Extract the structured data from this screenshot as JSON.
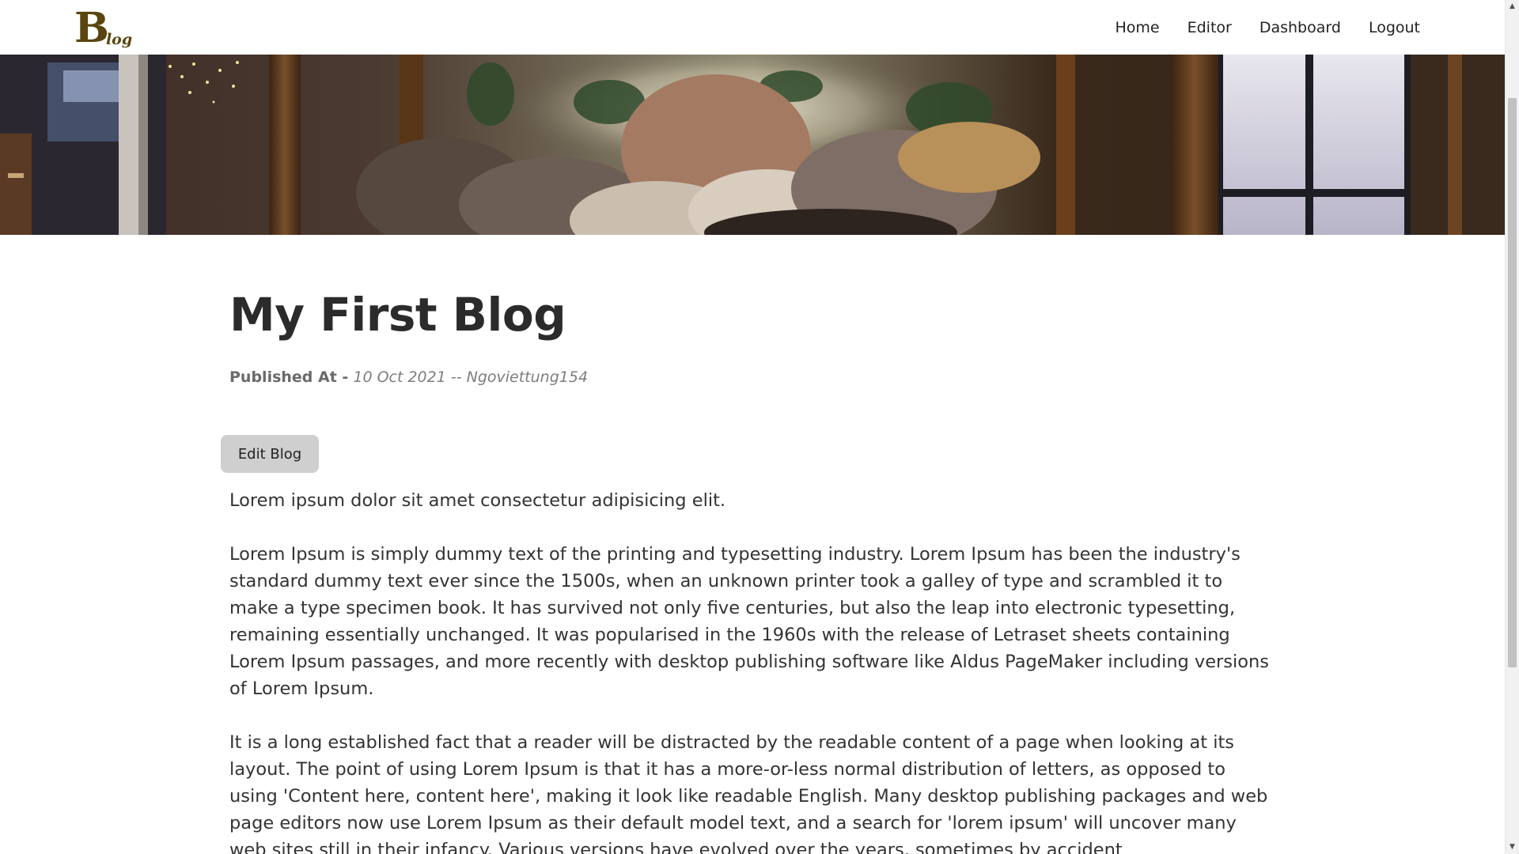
{
  "navbar": {
    "logo": {
      "initial": "B",
      "rest": "log"
    },
    "links": [
      {
        "label": "Home"
      },
      {
        "label": "Editor"
      },
      {
        "label": "Dashboard"
      },
      {
        "label": "Logout"
      }
    ]
  },
  "post": {
    "title": "My First Blog",
    "meta_label": "Published At -",
    "meta_date": "10 Oct 2021 -- Ngoviettung154",
    "edit_button_label": "Edit Blog",
    "paragraphs": [
      "Lorem ipsum dolor sit amet consectetur adipisicing elit.",
      "Lorem Ipsum is simply dummy text of the printing and typesetting industry. Lorem Ipsum has been the industry's standard dummy text ever since the 1500s, when an unknown printer took a galley of type and scrambled it to make a type specimen book. It has survived not only five centuries, but also the leap into electronic typesetting, remaining essentially unchanged. It was popularised in the 1960s with the release of Letraset sheets containing Lorem Ipsum passages, and more recently with desktop publishing software like Aldus PageMaker including versions of Lorem Ipsum.",
      "It is a long established fact that a reader will be distracted by the readable content of a page when looking at its layout. The point of using Lorem Ipsum is that it has a more-or-less normal distribution of letters, as opposed to using 'Content here, content here', making it look like readable English. Many desktop publishing packages and web page editors now use Lorem Ipsum as their default model text, and a search for 'lorem ipsum' will uncover many web sites still in their infancy. Various versions have evolved over the years, sometimes by accident"
    ]
  },
  "scrollbar": {
    "up_icon": "triangle-up-icon",
    "down_icon": "triangle-down-icon"
  },
  "colors": {
    "logo": "#5a4510",
    "text": "#333333",
    "title": "#2b2b2b",
    "button_bg": "#cfcfcf",
    "meta": "#777777"
  }
}
